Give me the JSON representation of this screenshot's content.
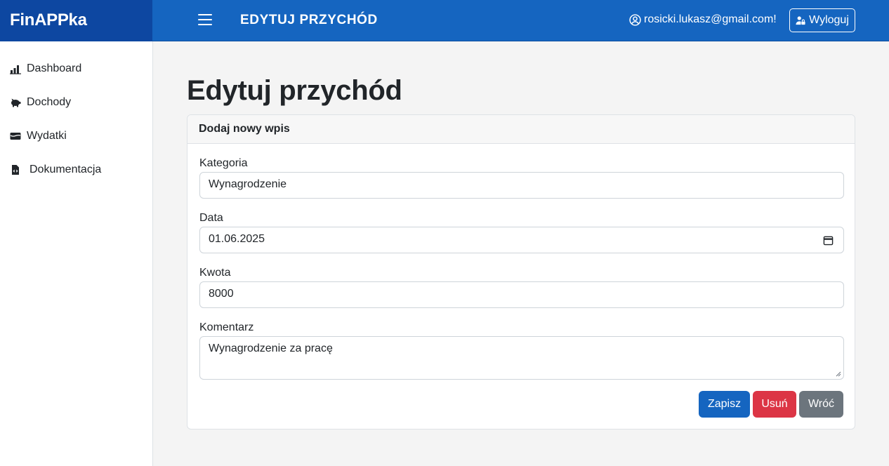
{
  "app": {
    "brand": "FinAPPka"
  },
  "header": {
    "title": "EDYTUJ PRZYCHÓD",
    "user_email": "rosicki.lukasz@gmail.com!",
    "logout_label": "Wyloguj"
  },
  "sidebar": {
    "items": [
      {
        "label": "Dashboard",
        "icon": "bar-chart-icon"
      },
      {
        "label": "Dochody",
        "icon": "piggy-bank-icon"
      },
      {
        "label": "Wydatki",
        "icon": "wallet-icon"
      },
      {
        "label": "Dokumentacja",
        "icon": "file-code-icon"
      }
    ]
  },
  "main": {
    "page_title": "Edytuj przychód",
    "card_header": "Dodaj nowy wpis",
    "form": {
      "category_label": "Kategoria",
      "category_value": "Wynagrodzenie",
      "date_label": "Data",
      "date_value": "01.06.2025",
      "amount_label": "Kwota",
      "amount_value": "8000",
      "comment_label": "Komentarz",
      "comment_value": "Wynagrodzenie za pracę"
    },
    "buttons": {
      "save": "Zapisz",
      "delete": "Usuń",
      "back": "Wróć"
    }
  },
  "colors": {
    "primary": "#1565c0",
    "brand_bg": "#0d47a1",
    "danger": "#dc3545",
    "secondary": "#6c757d"
  }
}
